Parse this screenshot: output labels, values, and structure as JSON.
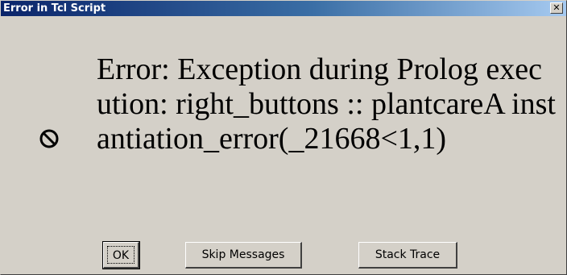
{
  "window": {
    "title": "Error in Tcl Script",
    "close_glyph": "✕"
  },
  "message": {
    "text": "Error: Exception during Prolog execution: right_buttons :: plantcareA instantiation_error(_21668<1,1)",
    "icon": "error-stop-icon"
  },
  "buttons": {
    "ok_label": "OK",
    "skip_label": "Skip Messages",
    "stack_label": "Stack Trace"
  },
  "colors": {
    "face": "#d4d0c8",
    "title_start": "#0a246a",
    "title_end": "#a6caf0"
  }
}
